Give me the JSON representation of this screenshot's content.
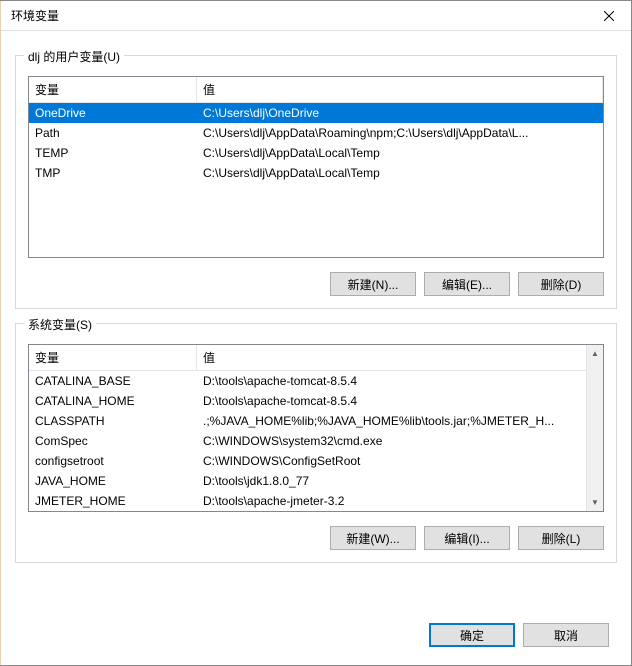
{
  "window": {
    "title": "环境变量"
  },
  "user_section": {
    "label": "dlj 的用户变量(U)",
    "columns": {
      "name": "变量",
      "value": "值"
    },
    "rows": [
      {
        "name": "OneDrive",
        "value": "C:\\Users\\dlj\\OneDrive",
        "selected": true
      },
      {
        "name": "Path",
        "value": "C:\\Users\\dlj\\AppData\\Roaming\\npm;C:\\Users\\dlj\\AppData\\L..."
      },
      {
        "name": "TEMP",
        "value": "C:\\Users\\dlj\\AppData\\Local\\Temp"
      },
      {
        "name": "TMP",
        "value": "C:\\Users\\dlj\\AppData\\Local\\Temp"
      }
    ],
    "buttons": {
      "new": "新建(N)...",
      "edit": "编辑(E)...",
      "delete": "删除(D)"
    }
  },
  "system_section": {
    "label": "系统变量(S)",
    "columns": {
      "name": "变量",
      "value": "值"
    },
    "rows": [
      {
        "name": "CATALINA_BASE",
        "value": "D:\\tools\\apache-tomcat-8.5.4"
      },
      {
        "name": "CATALINA_HOME",
        "value": "D:\\tools\\apache-tomcat-8.5.4"
      },
      {
        "name": "CLASSPATH",
        "value": ".;%JAVA_HOME%lib;%JAVA_HOME%lib\\tools.jar;%JMETER_H..."
      },
      {
        "name": "ComSpec",
        "value": "C:\\WINDOWS\\system32\\cmd.exe"
      },
      {
        "name": "configsetroot",
        "value": "C:\\WINDOWS\\ConfigSetRoot"
      },
      {
        "name": "JAVA_HOME",
        "value": "D:\\tools\\jdk1.8.0_77"
      },
      {
        "name": "JMETER_HOME",
        "value": "D:\\tools\\apache-jmeter-3.2"
      }
    ],
    "buttons": {
      "new": "新建(W)...",
      "edit": "编辑(I)...",
      "delete": "删除(L)"
    }
  },
  "footer": {
    "ok": "确定",
    "cancel": "取消"
  }
}
